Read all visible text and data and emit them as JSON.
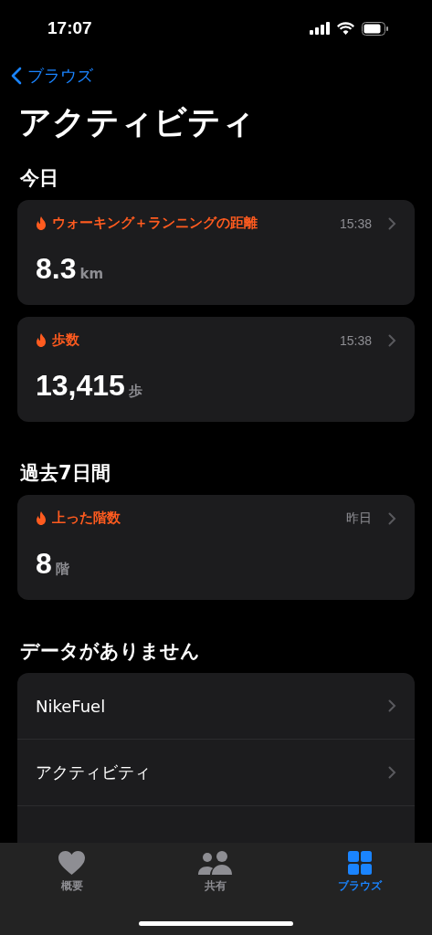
{
  "status_bar": {
    "time": "17:07"
  },
  "nav": {
    "back": "ブラウズ",
    "title": "アクティビティ"
  },
  "sections": [
    {
      "title": "今日",
      "cards": [
        {
          "label": "ウォーキング＋ランニングの距離",
          "time": "15:38",
          "value": "8.3",
          "unit": "km"
        },
        {
          "label": "歩数",
          "time": "15:38",
          "value": "13,415",
          "unit": "歩"
        }
      ]
    },
    {
      "title": "過去7日間",
      "cards": [
        {
          "label": "上った階数",
          "time": "昨日",
          "value": "8",
          "unit": "階"
        }
      ]
    }
  ],
  "no_data": {
    "title": "データがありません",
    "items": [
      {
        "label": "NikeFuel"
      },
      {
        "label": "アクティビティ"
      }
    ]
  },
  "tab_bar": [
    {
      "label": "概要",
      "kind": "heart",
      "selected": false
    },
    {
      "label": "共有",
      "kind": "people",
      "selected": false
    },
    {
      "label": "ブラウズ",
      "kind": "grid",
      "selected": true
    }
  ]
}
